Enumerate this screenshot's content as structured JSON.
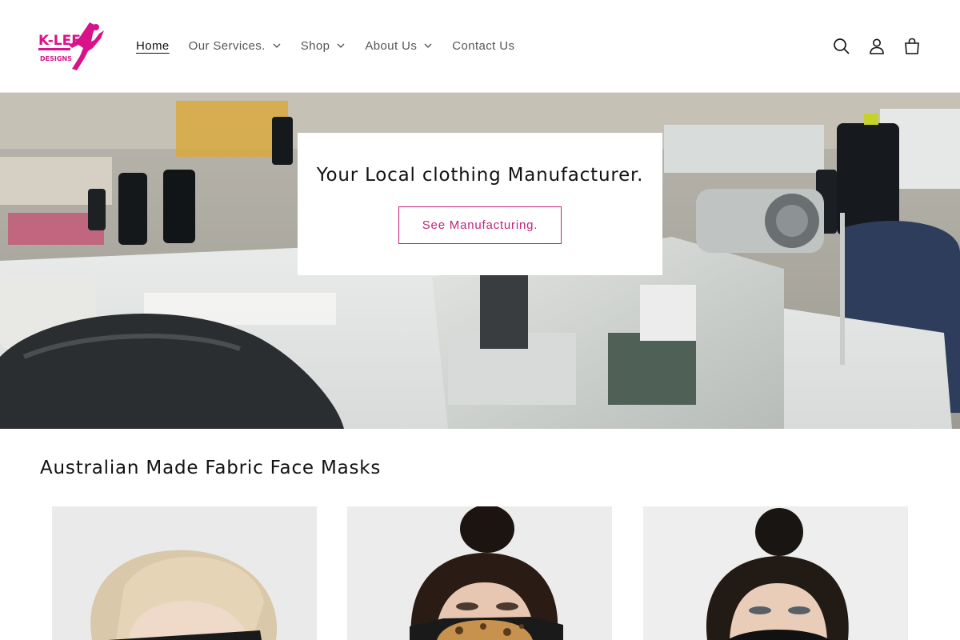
{
  "brand": {
    "logo_text_top": "K-LEE",
    "logo_text_bottom": "DESIGNS",
    "accent": "#d8138a"
  },
  "nav": {
    "items": [
      {
        "label": "Home",
        "active": true,
        "dropdown": false
      },
      {
        "label": "Our Services.",
        "active": false,
        "dropdown": true
      },
      {
        "label": "Shop",
        "active": false,
        "dropdown": true
      },
      {
        "label": "About Us",
        "active": false,
        "dropdown": true
      },
      {
        "label": "Contact Us",
        "active": false,
        "dropdown": false
      }
    ]
  },
  "header_icons": [
    "search-icon",
    "account-icon",
    "cart-icon"
  ],
  "hero": {
    "title": "Your Local clothing Manufacturer.",
    "button_label": "See Manufacturing.",
    "button_color": "#c1237d"
  },
  "collection": {
    "title": "Australian Made Fabric Face Masks",
    "products": [
      {
        "name": "product-card-1"
      },
      {
        "name": "product-card-2"
      },
      {
        "name": "product-card-3"
      }
    ]
  }
}
